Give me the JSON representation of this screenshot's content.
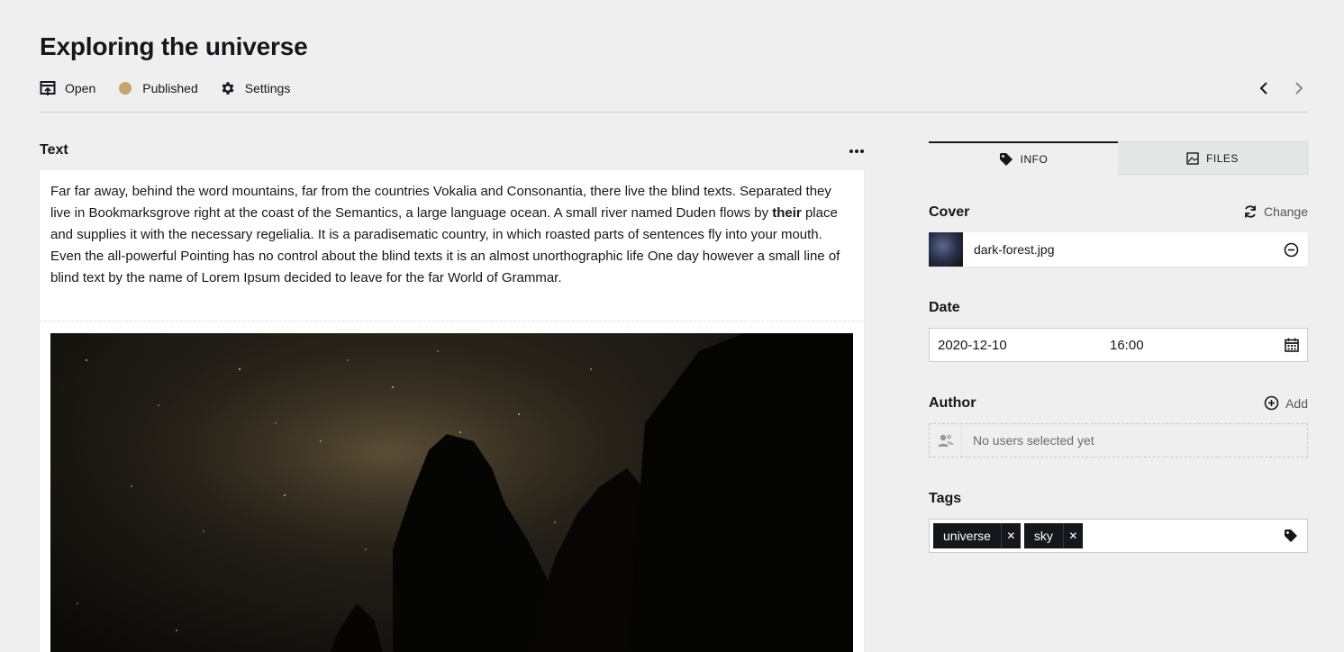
{
  "header": {
    "title": "Exploring the universe",
    "open_label": "Open",
    "status_label": "Published",
    "settings_label": "Settings",
    "status_color": "#c5a572"
  },
  "editor": {
    "section_label": "Text",
    "paragraph_before": "Far far away, behind the word mountains, far from the countries Vokalia and Consonantia, there live the blind texts. Separated they live in Bookmarksgrove right at the coast of the Semantics, a large language ocean. A small river named Duden flows by ",
    "paragraph_bold": "their",
    "paragraph_after": " place and supplies it with the necessary regelialia. It is a paradisematic country, in which roasted parts of sentences fly into your mouth. Even the all-powerful Pointing has no control about the blind texts it is an almost unorthographic life One day however a small line of blind text by the name of Lorem Ipsum decided to leave for the far World of Grammar."
  },
  "sidebar": {
    "tabs": [
      {
        "label": "INFO",
        "icon": "tag-icon",
        "active": true
      },
      {
        "label": "FILES",
        "icon": "image-icon",
        "active": false
      }
    ],
    "cover": {
      "label": "Cover",
      "action": "Change",
      "filename": "dark-forest.jpg"
    },
    "date": {
      "label": "Date",
      "date_value": "2020-12-10",
      "time_value": "16:00"
    },
    "author": {
      "label": "Author",
      "action": "Add",
      "empty": "No users selected yet"
    },
    "tags": {
      "label": "Tags",
      "items": [
        "universe",
        "sky"
      ]
    }
  },
  "colors": {
    "accent_dark": "#16171c",
    "background": "#efefef"
  }
}
